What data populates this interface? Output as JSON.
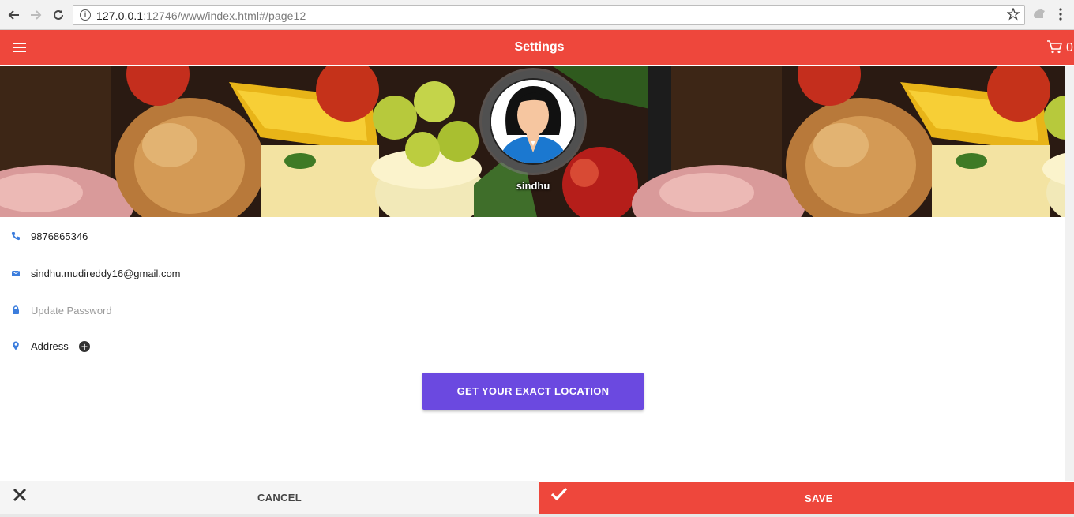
{
  "browser": {
    "url_host": "127.0.0.1",
    "url_rest": ":12746/www/index.html#/page12"
  },
  "header": {
    "title": "Settings",
    "cart_count": "0"
  },
  "profile": {
    "name": "sindhu",
    "phone": "9876865346",
    "email": "sindhu.mudireddy16@gmail.com",
    "password_placeholder": "Update Password",
    "address_label": "Address"
  },
  "actions": {
    "location_button": "GET YOUR EXACT LOCATION",
    "cancel_label": "CANCEL",
    "save_label": "SAVE"
  },
  "colors": {
    "brand": "#ee473c",
    "accent": "#6b49e0",
    "icon_blue": "#3b7ddd"
  },
  "icons": [
    "back-icon",
    "forward-icon",
    "reload-icon",
    "info-icon",
    "star-icon",
    "extension-icon",
    "menu-dots-icon",
    "hamburger-icon",
    "cart-icon",
    "phone-icon",
    "email-icon",
    "lock-icon",
    "location-pin-icon",
    "add-circle-icon",
    "close-icon",
    "check-icon"
  ]
}
